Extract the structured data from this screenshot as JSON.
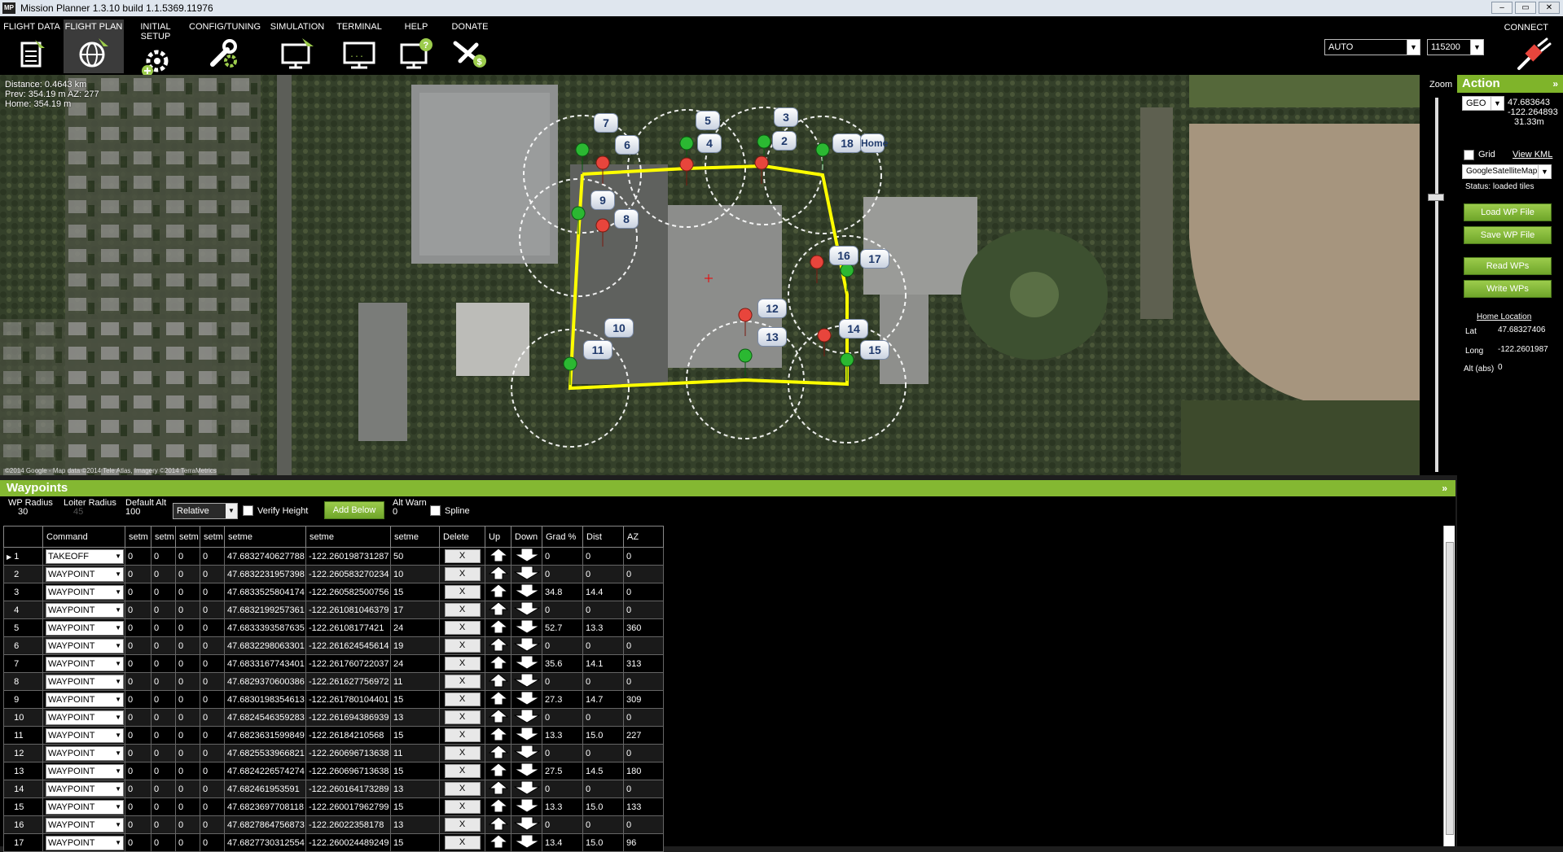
{
  "titlebar": {
    "title": "Mission Planner 1.3.10 build 1.1.5369.11976",
    "app_icon_text": "MP",
    "btn_min": "–",
    "btn_max": "▭",
    "btn_close": "✕"
  },
  "menu": [
    {
      "label": "FLIGHT DATA",
      "icon": "clipboard-plane-icon"
    },
    {
      "label": "FLIGHT PLAN",
      "icon": "globe-plane-icon"
    },
    {
      "label": "INITIAL SETUP",
      "icon": "gear-plus-icon"
    },
    {
      "label": "CONFIG/TUNING",
      "icon": "wrench-gear-icon"
    },
    {
      "label": "SIMULATION",
      "icon": "monitor-plane-icon"
    },
    {
      "label": "TERMINAL",
      "icon": "terminal-icon"
    },
    {
      "label": "HELP",
      "icon": "monitor-help-icon"
    },
    {
      "label": "DONATE",
      "icon": "plane-dollar-icon"
    }
  ],
  "connection": {
    "mode": "AUTO",
    "baud": "115200",
    "connect_label": "CONNECT"
  },
  "map": {
    "info_line1": "Distance: 0.4643 km",
    "info_line2": "Prev: 354.19 m AZ: 277",
    "info_line3": "Home: 354.19 m",
    "copyright": "©2014 Google - Map data ©2014 Tele Atlas, Imagery ©2014 TerraMetrics",
    "zoom_label": "Zoom",
    "home_label": "Home",
    "wp_labels": [
      "2",
      "3",
      "4",
      "5",
      "6",
      "7",
      "8",
      "9",
      "10",
      "11",
      "12",
      "13",
      "14",
      "15",
      "16",
      "17",
      "18"
    ]
  },
  "action": {
    "header": "Action",
    "coord_type": "GEO",
    "lat": "47.683643",
    "lng": "-122.264893",
    "alt": "31.33m",
    "grid_label": "Grid",
    "view_kml": "View KML",
    "map_type": "GoogleSatelliteMap",
    "status": "Status: loaded tiles",
    "load_wp": "Load WP File",
    "save_wp": "Save WP File",
    "read_wps": "Read WPs",
    "write_wps": "Write WPs",
    "home_location": "Home Location",
    "lat_label": "Lat",
    "long_label": "Long",
    "alt_label": "Alt (abs)",
    "home_lat": "47.68327406",
    "home_long": "-122.2601987",
    "home_alt": "0"
  },
  "waypoints": {
    "header": "Waypoints",
    "wp_radius_label": "WP Radius",
    "wp_radius": "30",
    "loiter_radius_label": "Loiter Radius",
    "loiter_radius": "45",
    "default_alt_label": "Default Alt",
    "default_alt": "100",
    "alt_frame": "Relative",
    "verify_height": "Verify Height",
    "add_below": "Add Below",
    "alt_warn_label": "Alt Warn",
    "alt_warn": "0",
    "spline": "Spline",
    "columns": [
      "Command",
      "setm",
      "setm",
      "setm",
      "setm",
      "setme",
      "setme",
      "setme",
      "Delete",
      "Up",
      "Down",
      "Grad %",
      "Dist",
      "AZ"
    ],
    "rows": [
      {
        "n": "1",
        "cmd": "TAKEOFF",
        "p1": "0",
        "p2": "0",
        "p3": "0",
        "p4": "0",
        "lat": "47.6832740627788",
        "lng": "-122.260198731287",
        "alt": "50",
        "grad": "0",
        "dist": "0",
        "az": "0"
      },
      {
        "n": "2",
        "cmd": "WAYPOINT",
        "p1": "0",
        "p2": "0",
        "p3": "0",
        "p4": "0",
        "lat": "47.6832231957398",
        "lng": "-122.260583270234",
        "alt": "10",
        "grad": "0",
        "dist": "0",
        "az": "0"
      },
      {
        "n": "3",
        "cmd": "WAYPOINT",
        "p1": "0",
        "p2": "0",
        "p3": "0",
        "p4": "0",
        "lat": "47.6833525804174",
        "lng": "-122.260582500756",
        "alt": "15",
        "grad": "34.8",
        "dist": "14.4",
        "az": "0"
      },
      {
        "n": "4",
        "cmd": "WAYPOINT",
        "p1": "0",
        "p2": "0",
        "p3": "0",
        "p4": "0",
        "lat": "47.6832199257361",
        "lng": "-122.261081046379",
        "alt": "17",
        "grad": "0",
        "dist": "0",
        "az": "0"
      },
      {
        "n": "5",
        "cmd": "WAYPOINT",
        "p1": "0",
        "p2": "0",
        "p3": "0",
        "p4": "0",
        "lat": "47.6833393587635",
        "lng": "-122.26108177421",
        "alt": "24",
        "grad": "52.7",
        "dist": "13.3",
        "az": "360"
      },
      {
        "n": "6",
        "cmd": "WAYPOINT",
        "p1": "0",
        "p2": "0",
        "p3": "0",
        "p4": "0",
        "lat": "47.6832298063301",
        "lng": "-122.261624545614",
        "alt": "19",
        "grad": "0",
        "dist": "0",
        "az": "0"
      },
      {
        "n": "7",
        "cmd": "WAYPOINT",
        "p1": "0",
        "p2": "0",
        "p3": "0",
        "p4": "0",
        "lat": "47.6833167743401",
        "lng": "-122.261760722037",
        "alt": "24",
        "grad": "35.6",
        "dist": "14.1",
        "az": "313"
      },
      {
        "n": "8",
        "cmd": "WAYPOINT",
        "p1": "0",
        "p2": "0",
        "p3": "0",
        "p4": "0",
        "lat": "47.6829370600386",
        "lng": "-122.261627756972",
        "alt": "11",
        "grad": "0",
        "dist": "0",
        "az": "0"
      },
      {
        "n": "9",
        "cmd": "WAYPOINT",
        "p1": "0",
        "p2": "0",
        "p3": "0",
        "p4": "0",
        "lat": "47.6830198354613",
        "lng": "-122.261780104401",
        "alt": "15",
        "grad": "27.3",
        "dist": "14.7",
        "az": "309"
      },
      {
        "n": "10",
        "cmd": "WAYPOINT",
        "p1": "0",
        "p2": "0",
        "p3": "0",
        "p4": "0",
        "lat": "47.6824546359283",
        "lng": "-122.261694386939",
        "alt": "13",
        "grad": "0",
        "dist": "0",
        "az": "0"
      },
      {
        "n": "11",
        "cmd": "WAYPOINT",
        "p1": "0",
        "p2": "0",
        "p3": "0",
        "p4": "0",
        "lat": "47.6823631599849",
        "lng": "-122.26184210568",
        "alt": "15",
        "grad": "13.3",
        "dist": "15.0",
        "az": "227"
      },
      {
        "n": "12",
        "cmd": "WAYPOINT",
        "p1": "0",
        "p2": "0",
        "p3": "0",
        "p4": "0",
        "lat": "47.6825533966821",
        "lng": "-122.260696713638",
        "alt": "11",
        "grad": "0",
        "dist": "0",
        "az": "0"
      },
      {
        "n": "13",
        "cmd": "WAYPOINT",
        "p1": "0",
        "p2": "0",
        "p3": "0",
        "p4": "0",
        "lat": "47.6824226574274",
        "lng": "-122.260696713638",
        "alt": "15",
        "grad": "27.5",
        "dist": "14.5",
        "az": "180"
      },
      {
        "n": "14",
        "cmd": "WAYPOINT",
        "p1": "0",
        "p2": "0",
        "p3": "0",
        "p4": "0",
        "lat": "47.682461953591",
        "lng": "-122.260164173289",
        "alt": "13",
        "grad": "0",
        "dist": "0",
        "az": "0"
      },
      {
        "n": "15",
        "cmd": "WAYPOINT",
        "p1": "0",
        "p2": "0",
        "p3": "0",
        "p4": "0",
        "lat": "47.6823697708118",
        "lng": "-122.260017962799",
        "alt": "15",
        "grad": "13.3",
        "dist": "15.0",
        "az": "133"
      },
      {
        "n": "16",
        "cmd": "WAYPOINT",
        "p1": "0",
        "p2": "0",
        "p3": "0",
        "p4": "0",
        "lat": "47.6827864756873",
        "lng": "-122.26022358178",
        "alt": "13",
        "grad": "0",
        "dist": "0",
        "az": "0"
      },
      {
        "n": "17",
        "cmd": "WAYPOINT",
        "p1": "0",
        "p2": "0",
        "p3": "0",
        "p4": "0",
        "lat": "47.6827730312554",
        "lng": "-122.260024489249",
        "alt": "15",
        "grad": "13.4",
        "dist": "15.0",
        "az": "96"
      }
    ],
    "delete_label": "X",
    "up_icon": "up-arrow-icon",
    "down_icon": "down-arrow-icon"
  },
  "colors": {
    "accent_green": "#84b832",
    "path_yellow": "#ffff00",
    "marker_green": "#2bb832",
    "marker_red": "#e8453c"
  }
}
